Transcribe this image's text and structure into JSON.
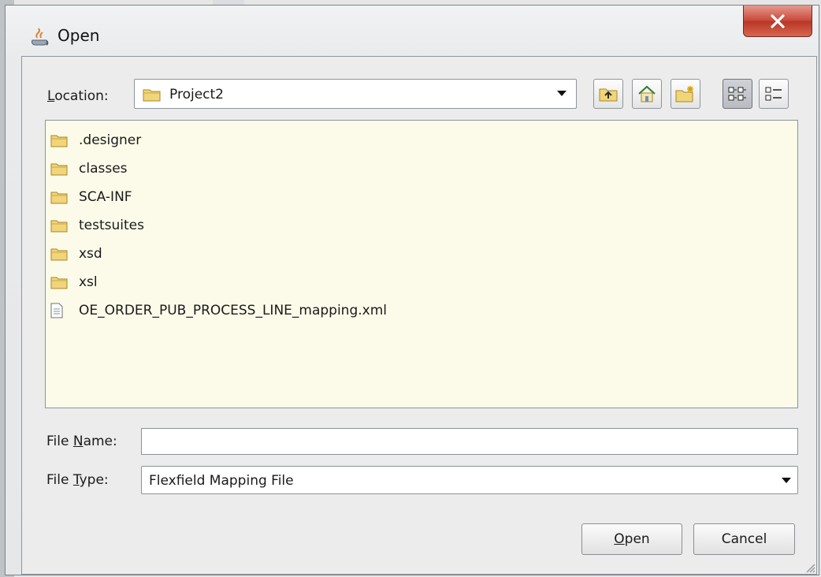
{
  "window": {
    "title": "Open",
    "close_glyph": "X"
  },
  "location": {
    "label": "Location:",
    "value": "Project2",
    "icon": "folder-icon"
  },
  "toolbar": [
    {
      "name": "up-folder-button",
      "icon": "folder-up-icon"
    },
    {
      "name": "home-button",
      "icon": "home-icon"
    },
    {
      "name": "new-folder-button",
      "icon": "new-folder-icon"
    },
    {
      "name": "list-view-button",
      "icon": "list-view-icon",
      "active": true
    },
    {
      "name": "details-view-button",
      "icon": "details-view-icon"
    }
  ],
  "files": [
    {
      "name": ".designer",
      "type": "folder"
    },
    {
      "name": "classes",
      "type": "folder"
    },
    {
      "name": "SCA-INF",
      "type": "folder"
    },
    {
      "name": "testsuites",
      "type": "folder"
    },
    {
      "name": "xsd",
      "type": "folder"
    },
    {
      "name": "xsl",
      "type": "folder"
    },
    {
      "name": "OE_ORDER_PUB_PROCESS_LINE_mapping.xml",
      "type": "file"
    }
  ],
  "file_name": {
    "label": "File Name:",
    "value": ""
  },
  "file_type": {
    "label": "File Type:",
    "value": "Flexfield Mapping File"
  },
  "buttons": {
    "open": "Open",
    "cancel": "Cancel"
  },
  "colors": {
    "list_bg": "#fcfbea",
    "folder": "#e8c44a",
    "close_red": "#c8473a"
  }
}
